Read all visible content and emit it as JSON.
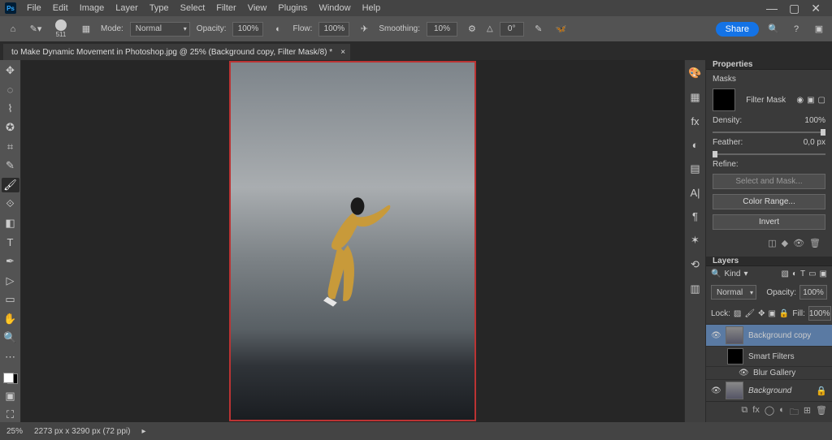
{
  "menu": [
    "File",
    "Edit",
    "Image",
    "Layer",
    "Type",
    "Select",
    "Filter",
    "View",
    "Plugins",
    "Window",
    "Help"
  ],
  "options": {
    "brush_size": "511",
    "mode_label": "Mode:",
    "mode_value": "Normal",
    "opacity_label": "Opacity:",
    "opacity_value": "100%",
    "flow_label": "Flow:",
    "flow_value": "100%",
    "smoothing_label": "Smoothing:",
    "smoothing_value": "10%",
    "angle_label": "△",
    "angle_value": "0°",
    "share": "Share"
  },
  "document_tab": "to Make Dynamic Movement in Photoshop.jpg @ 25% (Background copy, Filter Mask/8) *",
  "properties": {
    "panel_title": "Properties",
    "section": "Masks",
    "mask_label": "Filter Mask",
    "density_label": "Density:",
    "density_value": "100%",
    "feather_label": "Feather:",
    "feather_value": "0,0 px",
    "refine_label": "Refine:",
    "select_mask": "Select and Mask...",
    "color_range": "Color Range...",
    "invert": "Invert"
  },
  "layers": {
    "panel_title": "Layers",
    "filter_label": "Kind",
    "blend_mode": "Normal",
    "opacity_label": "Opacity:",
    "opacity_value": "100%",
    "lock_label": "Lock:",
    "fill_label": "Fill:",
    "fill_value": "100%",
    "rows": [
      {
        "name": "Background copy",
        "italic": false,
        "selected": true
      },
      {
        "name": "Smart Filters",
        "italic": false,
        "selected": false,
        "indent": 1,
        "smart": true
      },
      {
        "name": "Blur Gallery",
        "italic": false,
        "selected": false,
        "indent": 2,
        "filterline": true
      },
      {
        "name": "Background",
        "italic": true,
        "selected": false,
        "locked": true
      }
    ]
  },
  "status": {
    "zoom": "25%",
    "dims": "2273 px x 3290 px (72 ppi)"
  }
}
